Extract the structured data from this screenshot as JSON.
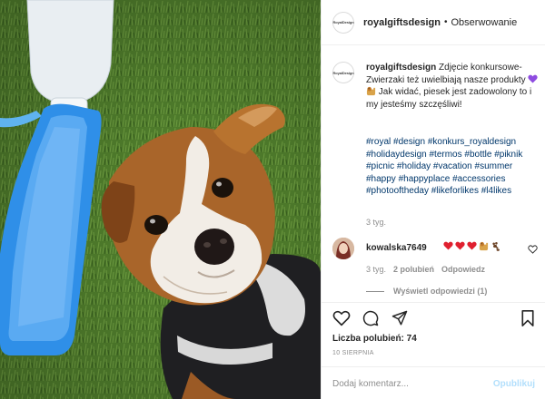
{
  "post_header": {
    "avatar_text": "RoyalDesign",
    "username": "royalgiftsdesign",
    "separator": "•",
    "follow_label": "Obserwowanie"
  },
  "caption": {
    "username": "royalgiftsdesign",
    "text_part1": "Zdjęcie konkursowe- Zwierzaki też uwielbiają nasze produkty",
    "text_part2": "Jak widać, piesek jest zadowolony to i my jesteśmy szczęśliwi!",
    "hashtags": "#royal #design #konkurs_royaldesign #holidaydesign #termos #bottle #piknik #picnic #holiday #vacation #summer #happy #happyplace #accessories #photooftheday #likeforlikes #l4likes",
    "time": "3 tyg.",
    "emoji": [
      "purple-heart-emoji",
      "dog-emoji"
    ]
  },
  "comment": {
    "username": "kowalska7649",
    "emoji": [
      "red-heart-emoji",
      "red-heart-emoji",
      "red-heart-emoji",
      "dog-emoji",
      "paw-prints-emoji"
    ],
    "time": "3 tyg.",
    "likes": "2 polubień",
    "reply_label": "Odpowiedz",
    "view_replies": "Wyświetl odpowiedzi (1)"
  },
  "actions": {
    "icons": [
      "heart-icon",
      "comment-icon",
      "share-icon",
      "bookmark-icon"
    ],
    "likes_text": "Liczba polubień: 74",
    "date": "10 SIERPNIA"
  },
  "add_comment": {
    "placeholder": "Dodaj komentarz...",
    "post_label": "Opublikuj"
  },
  "colors": {
    "hashtag": "#00376b",
    "muted": "#8e8e8e",
    "border": "#efefef",
    "post_disabled": "#b2dffc",
    "bottle_blue": "#2f8fe8"
  }
}
